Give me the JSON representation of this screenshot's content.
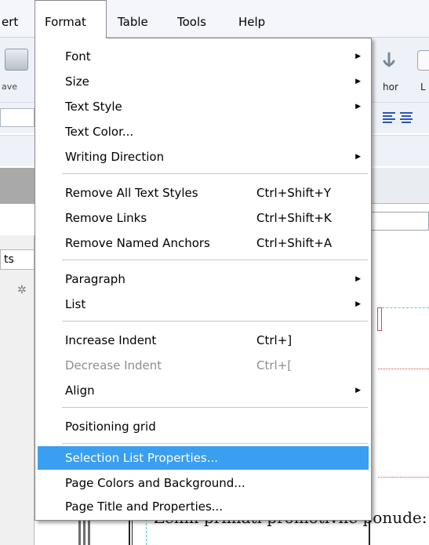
{
  "menubar": {
    "items": [
      {
        "label": "ert"
      },
      {
        "label": "Format"
      },
      {
        "label": "Table"
      },
      {
        "label": "Tools"
      },
      {
        "label": "Help"
      }
    ]
  },
  "toolbar": {
    "save_label": "ave",
    "anchor_label": "hor",
    "link_label": "L"
  },
  "side_panel": {
    "tab_label": "ts"
  },
  "document": {
    "visible_text": "Zelim primati promotivne ponude:"
  },
  "format_menu": {
    "items": [
      {
        "label": "Font",
        "shortcut": "",
        "submenu": true
      },
      {
        "label": "Size",
        "shortcut": "",
        "submenu": true
      },
      {
        "label": "Text Style",
        "shortcut": "",
        "submenu": true
      },
      {
        "label": "Text Color...",
        "shortcut": "",
        "submenu": false
      },
      {
        "label": "Writing Direction",
        "shortcut": "",
        "submenu": true
      },
      {
        "label": "Remove All Text Styles",
        "shortcut": "Ctrl+Shift+Y"
      },
      {
        "label": "Remove Links",
        "shortcut": "Ctrl+Shift+K"
      },
      {
        "label": "Remove Named Anchors",
        "shortcut": "Ctrl+Shift+A"
      },
      {
        "label": "Paragraph",
        "shortcut": "",
        "submenu": true
      },
      {
        "label": "List",
        "shortcut": "",
        "submenu": true
      },
      {
        "label": "Increase Indent",
        "shortcut": "Ctrl+]"
      },
      {
        "label": "Decrease Indent",
        "shortcut": "Ctrl+[",
        "disabled": true
      },
      {
        "label": "Align",
        "shortcut": "",
        "submenu": true
      },
      {
        "label": "Positioning grid",
        "shortcut": ""
      },
      {
        "label": "Selection List Properties...",
        "shortcut": "",
        "highlighted": true
      },
      {
        "label": "Page Colors and Background...",
        "shortcut": ""
      },
      {
        "label": "Page Title and Properties...",
        "shortcut": ""
      }
    ],
    "submenu_arrow": "▶"
  },
  "colors": {
    "highlight": "#3a9ff0",
    "disabled_text": "#8d8d8d",
    "menubar_bg": "#f4f6fb"
  }
}
